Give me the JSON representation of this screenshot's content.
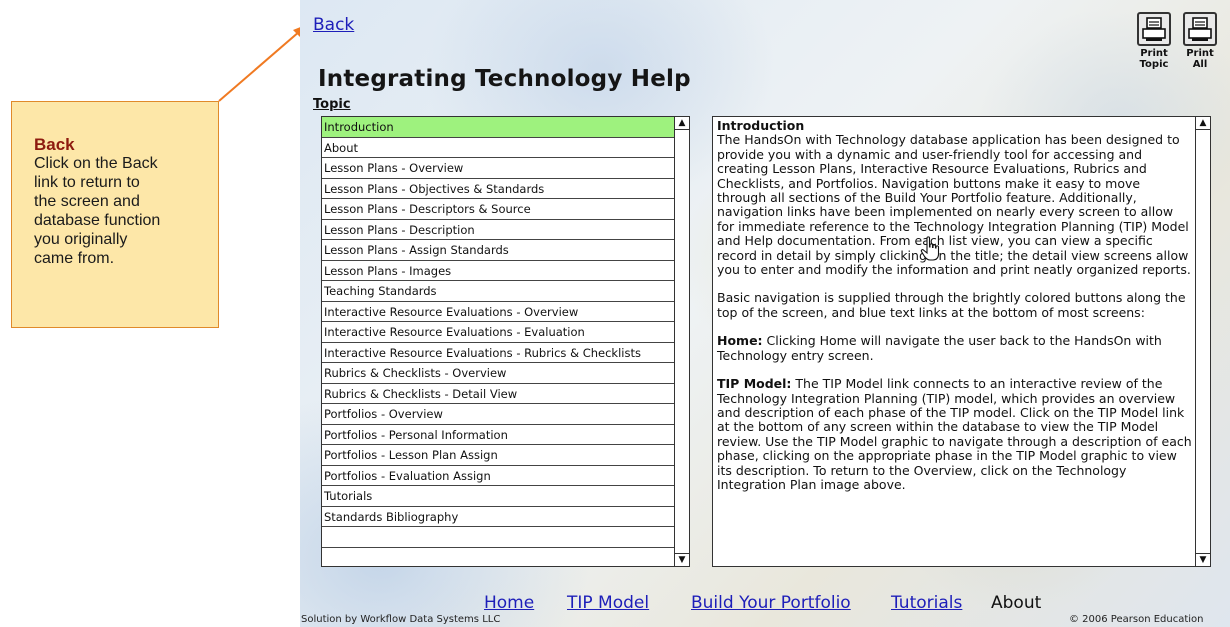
{
  "callout": {
    "title": "Back",
    "body": "Click on the Back\nlink to return to\nthe screen and\ndatabase function\nyou originally\ncame from."
  },
  "app": {
    "back_label": "Back",
    "title": "Integrating Technology Help",
    "topic_label": "Topic",
    "print_topic_label": "Print\nTopic",
    "print_all_label": "Print\nAll",
    "print_icon": "printer-icon"
  },
  "topics": [
    "Introduction",
    "About",
    "Lesson Plans - Overview",
    "Lesson Plans - Objectives & Standards",
    "Lesson Plans - Descriptors & Source",
    "Lesson Plans - Description",
    "Lesson Plans - Assign Standards",
    "Lesson Plans - Images",
    "Teaching Standards",
    "Interactive Resource Evaluations - Overview",
    "Interactive Resource Evaluations - Evaluation",
    "Interactive Resource Evaluations - Rubrics & Checklists",
    "Rubrics & Checklists - Overview",
    "Rubrics & Checklists - Detail View",
    "Portfolios - Overview",
    "Portfolios - Personal Information",
    "Portfolios - Lesson Plan Assign",
    "Portfolios - Evaluation Assign",
    "Tutorials",
    "Standards Bibliography",
    "",
    ""
  ],
  "selected_topic_index": 0,
  "content": {
    "heading": "Introduction",
    "p1": "The HandsOn with Technology database application has been designed to provide you with a dynamic and user-friendly tool for accessing and creating Lesson Plans, Interactive Resource Evaluations, Rubrics and Checklists, and Portfolios. Navigation buttons make it easy to move through all sections of the Build Your Portfolio feature. Additionally, navigation links have been implemented on nearly every screen to allow for immediate reference to the Technology Integration Planning (TIP) Model and Help documentation. From each list view, you can view a specific record in detail by simply clicking on the title; the detail view screens allow you to enter and modify the information and print neatly organized reports.",
    "p2": "Basic navigation is supplied through the brightly colored buttons along the top of the screen, and blue text links at the bottom of most screens:",
    "p3_label": "Home:",
    "p3_text": " Clicking Home will navigate the user back to the HandsOn with Technology entry screen.",
    "p4_label": "TIP Model:",
    "p4_text": " The TIP Model link connects to an interactive review of the Technology Integration Planning (TIP) model, which provides an overview and description of each phase of the TIP model. Click on the TIP Model link at the bottom of any screen within the database to view the TIP Model review. Use the TIP Model graphic to navigate through a description of each phase, clicking on the appropriate phase in the TIP Model graphic to view its description. To return to the Overview, click on the Technology Integration Plan image above."
  },
  "footer": {
    "home": "Home",
    "tip_model": "TIP Model",
    "build_portfolio": "Build Your Portfolio",
    "tutorials": "Tutorials",
    "about": "About",
    "credit_left": "Solution by Workflow Data Systems LLC",
    "credit_right": "© 2006 Pearson Education"
  },
  "colors": {
    "link": "#1d1eb9",
    "selected_row": "#9ef27e",
    "callout_bg": "#fde7a8",
    "callout_title": "#8e1b0f",
    "arrow": "#f07a22"
  }
}
